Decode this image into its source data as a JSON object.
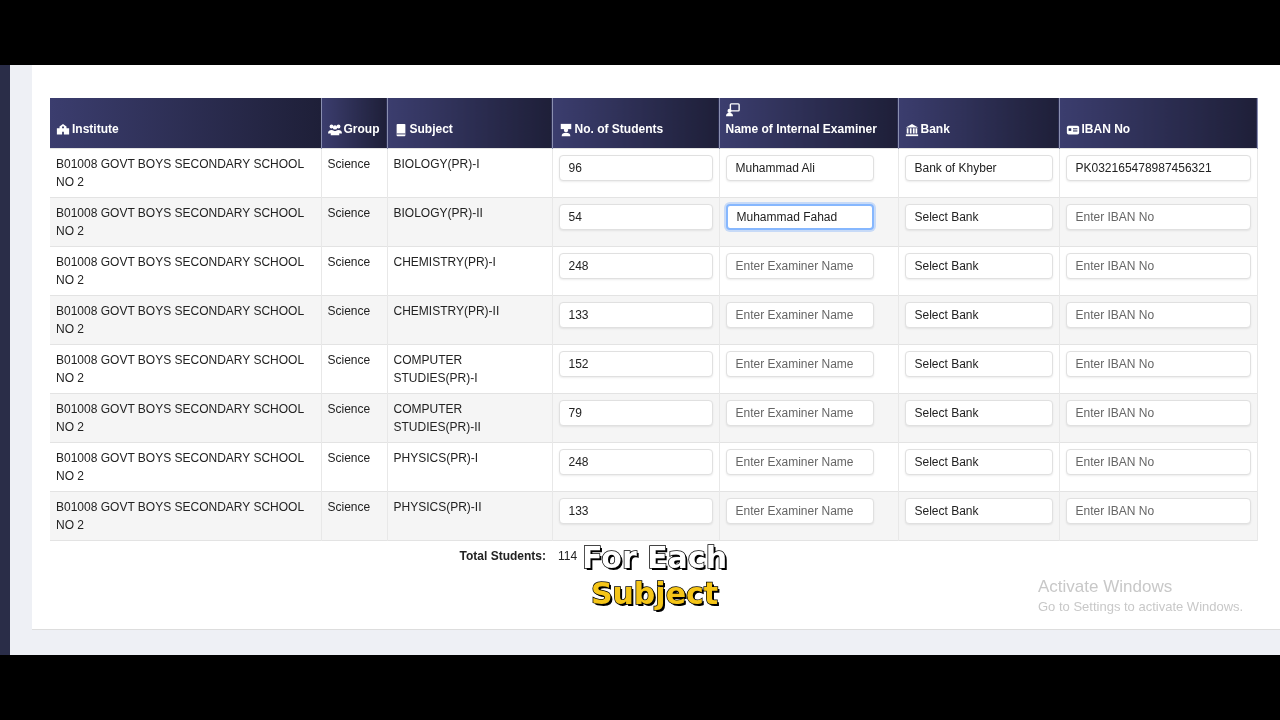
{
  "table": {
    "columns": [
      {
        "label": "Institute"
      },
      {
        "label": "Group"
      },
      {
        "label": "Subject"
      },
      {
        "label": "No. of Students"
      },
      {
        "label": "Name of Internal Examiner"
      },
      {
        "label": "Bank"
      },
      {
        "label": "IBAN No"
      }
    ],
    "rows": [
      {
        "institute": "B01008 GOVT BOYS SECONDARY SCHOOL NO 2",
        "group": "Science",
        "subject": "BIOLOGY(PR)-I",
        "students": "96",
        "examiner": {
          "value": "Muhammad Ali",
          "focused": false
        },
        "bank": "Bank of Khyber",
        "iban": {
          "value": "PK032165478987456321"
        }
      },
      {
        "institute": "B01008 GOVT BOYS SECONDARY SCHOOL NO 2",
        "group": "Science",
        "subject": "BIOLOGY(PR)-II",
        "students": "54",
        "examiner": {
          "value": "Muhammad Fahad",
          "focused": true
        },
        "bank": "Select Bank",
        "iban": {
          "placeholder": "Enter IBAN No"
        }
      },
      {
        "institute": "B01008 GOVT BOYS SECONDARY SCHOOL NO 2",
        "group": "Science",
        "subject": "CHEMISTRY(PR)-I",
        "students": "248",
        "examiner": {
          "placeholder": "Enter Examiner Name",
          "focused": false
        },
        "bank": "Select Bank",
        "iban": {
          "placeholder": "Enter IBAN No"
        }
      },
      {
        "institute": "B01008 GOVT BOYS SECONDARY SCHOOL NO 2",
        "group": "Science",
        "subject": "CHEMISTRY(PR)-II",
        "students": "133",
        "examiner": {
          "placeholder": "Enter Examiner Name",
          "focused": false
        },
        "bank": "Select Bank",
        "iban": {
          "placeholder": "Enter IBAN No"
        }
      },
      {
        "institute": "B01008 GOVT BOYS SECONDARY SCHOOL NO 2",
        "group": "Science",
        "subject": "COMPUTER STUDIES(PR)-I",
        "students": "152",
        "examiner": {
          "placeholder": "Enter Examiner Name",
          "focused": false
        },
        "bank": "Select Bank",
        "iban": {
          "placeholder": "Enter IBAN No"
        }
      },
      {
        "institute": "B01008 GOVT BOYS SECONDARY SCHOOL NO 2",
        "group": "Science",
        "subject": "COMPUTER STUDIES(PR)-II",
        "students": "79",
        "examiner": {
          "placeholder": "Enter Examiner Name",
          "focused": false
        },
        "bank": "Select Bank",
        "iban": {
          "placeholder": "Enter IBAN No"
        }
      },
      {
        "institute": "B01008 GOVT BOYS SECONDARY SCHOOL NO 2",
        "group": "Science",
        "subject": "PHYSICS(PR)-I",
        "students": "248",
        "examiner": {
          "placeholder": "Enter Examiner Name",
          "focused": false
        },
        "bank": "Select Bank",
        "iban": {
          "placeholder": "Enter IBAN No"
        }
      },
      {
        "institute": "B01008 GOVT BOYS SECONDARY SCHOOL NO 2",
        "group": "Science",
        "subject": "PHYSICS(PR)-II",
        "students": "133",
        "examiner": {
          "placeholder": "Enter Examiner Name",
          "focused": false
        },
        "bank": "Select Bank",
        "iban": {
          "placeholder": "Enter IBAN No"
        }
      }
    ],
    "total": {
      "label": "Total Students:",
      "value": "114"
    }
  },
  "caption": [
    "For Each",
    "Subject"
  ],
  "os_notice": {
    "title": "Activate Windows",
    "subtitle": "Go to Settings to activate Windows."
  }
}
